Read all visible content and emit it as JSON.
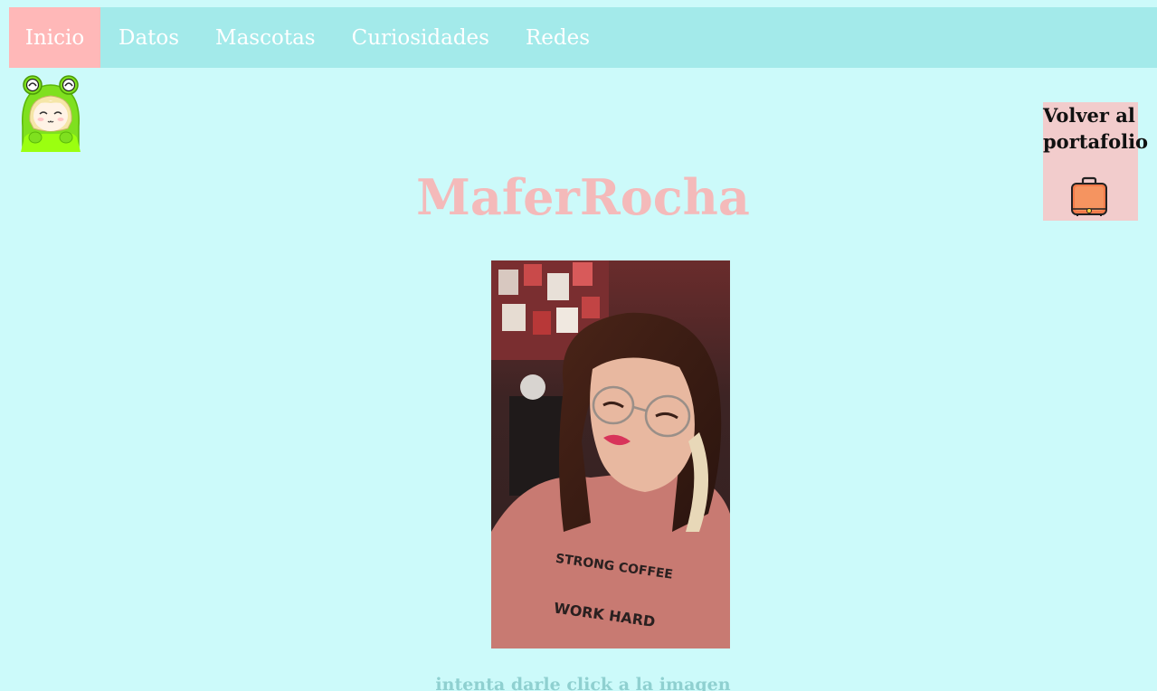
{
  "nav": {
    "items": [
      {
        "label": "Inicio",
        "active": true
      },
      {
        "label": "Datos",
        "active": false
      },
      {
        "label": "Mascotas",
        "active": false
      },
      {
        "label": "Curiosidades",
        "active": false
      },
      {
        "label": "Redes",
        "active": false
      }
    ]
  },
  "portfolio": {
    "label_line1": "Volver al",
    "label_line2": "portafolio",
    "icon": "briefcase-icon"
  },
  "main": {
    "title": "MaferRocha",
    "photo_alt": "profile-photo",
    "hint": "intenta darle click a la imagen"
  },
  "colors": {
    "background": "#ccfafa",
    "navbar": "#a3eaea",
    "nav_active": "#ffb8b8",
    "title": "#f4baba",
    "hint": "#8fd0d0",
    "portfolio_box": "#f2cccc"
  }
}
